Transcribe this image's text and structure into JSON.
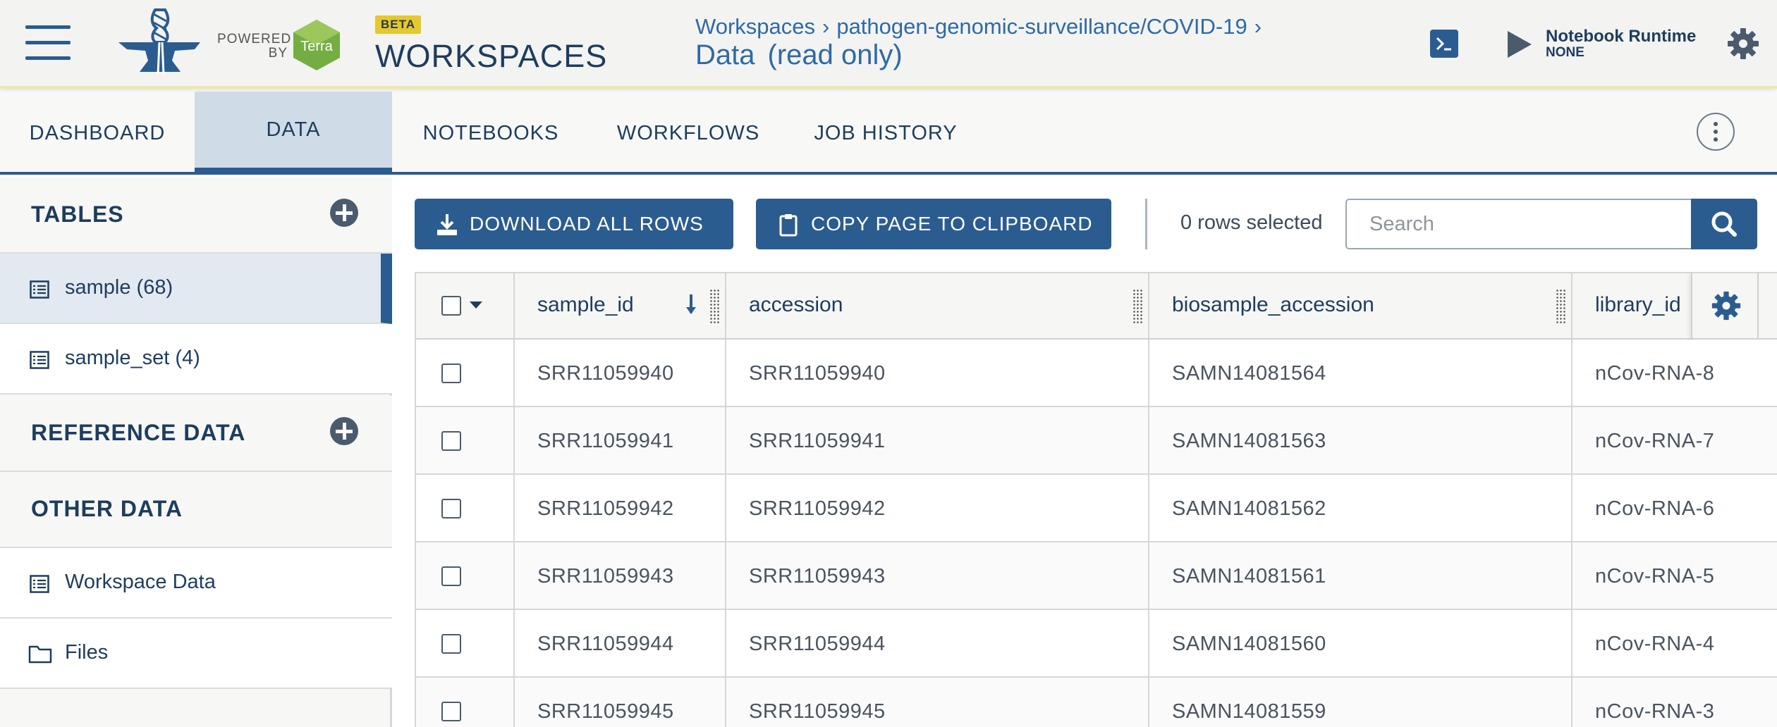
{
  "header": {
    "app_title": "WORKSPACES",
    "beta_badge": "BETA",
    "powered_by": "POWERED BY",
    "terra_logo_text": "Terra",
    "breadcrumb": [
      "Workspaces",
      "pathogen-genomic-surveillance/COVID-19"
    ],
    "breadcrumb_separator": "›",
    "page_title": "Data",
    "page_subtitle": "(read only)",
    "runtime_label": "Notebook Runtime",
    "runtime_status": "NONE"
  },
  "tabs": [
    {
      "label": "DASHBOARD",
      "active": false
    },
    {
      "label": "DATA",
      "active": true
    },
    {
      "label": "NOTEBOOKS",
      "active": false
    },
    {
      "label": "WORKFLOWS",
      "active": false
    },
    {
      "label": "JOB HISTORY",
      "active": false
    }
  ],
  "sidebar": {
    "tables_title": "TABLES",
    "tables": [
      {
        "label": "sample (68)",
        "selected": true
      },
      {
        "label": "sample_set (4)",
        "selected": false
      }
    ],
    "reference_title": "REFERENCE DATA",
    "other_title": "OTHER DATA",
    "other_items": [
      {
        "label": "Workspace Data",
        "icon": "table-icon"
      },
      {
        "label": "Files",
        "icon": "folder-icon"
      }
    ]
  },
  "toolbar": {
    "download_label": "DOWNLOAD ALL ROWS",
    "copy_label": "COPY PAGE TO CLIPBOARD",
    "rows_selected": "0 rows selected",
    "search_placeholder": "Search"
  },
  "table": {
    "columns": [
      "sample_id",
      "accession",
      "biosample_accession",
      "library_id"
    ],
    "rows": [
      [
        "SRR11059940",
        "SRR11059940",
        "SAMN14081564",
        "nCov-RNA-8"
      ],
      [
        "SRR11059941",
        "SRR11059941",
        "SAMN14081563",
        "nCov-RNA-7"
      ],
      [
        "SRR11059942",
        "SRR11059942",
        "SAMN14081562",
        "nCov-RNA-6"
      ],
      [
        "SRR11059943",
        "SRR11059943",
        "SAMN14081561",
        "nCov-RNA-5"
      ],
      [
        "SRR11059944",
        "SRR11059944",
        "SAMN14081560",
        "nCov-RNA-4"
      ],
      [
        "SRR11059945",
        "SRR11059945",
        "SAMN14081559",
        "nCov-RNA-3"
      ]
    ]
  },
  "colors": {
    "primary": "#2b5c8f",
    "header_bg": "#f3f3f1",
    "beta": "#e5c82d",
    "terra_green": "#74ae43",
    "selected_bg": "#e2e9f0"
  }
}
